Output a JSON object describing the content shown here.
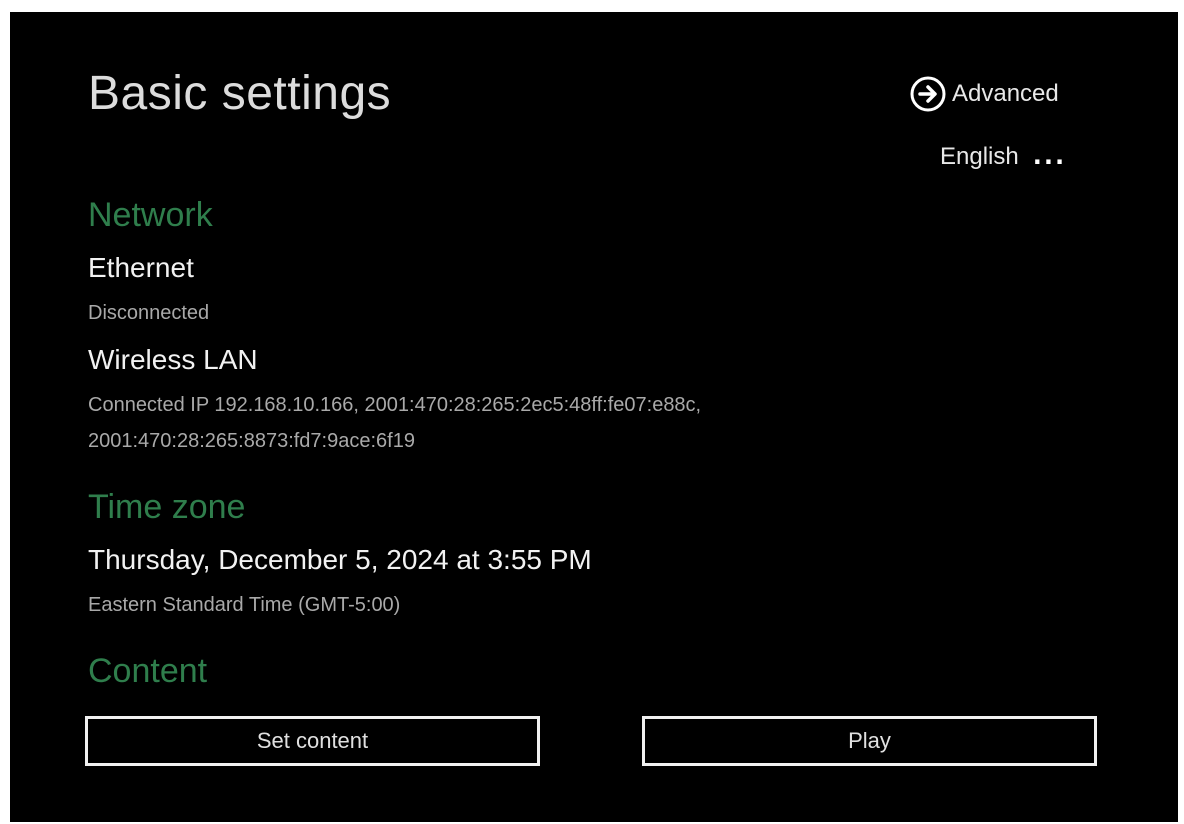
{
  "header": {
    "title": "Basic settings",
    "advanced_label": "Advanced",
    "language_label": "English",
    "more_label": "..."
  },
  "network": {
    "heading": "Network",
    "ethernet": {
      "title": "Ethernet",
      "status": "Disconnected"
    },
    "wireless": {
      "title": "Wireless LAN",
      "status_line1": "Connected IP 192.168.10.166, 2001:470:28:265:2ec5:48ff:fe07:e88c,",
      "status_line2": "2001:470:28:265:8873:fd7:9ace:6f19"
    }
  },
  "time_zone": {
    "heading": "Time zone",
    "datetime": "Thursday, December 5, 2024 at 3:55 PM",
    "zone": "Eastern Standard Time (GMT-5:00)"
  },
  "content": {
    "heading": "Content",
    "set_content_label": "Set content",
    "play_label": "Play"
  },
  "colors": {
    "background": "#000000",
    "section_heading": "#2f7e4c",
    "text": "#f2f2f2",
    "subtext": "#a9a9a9"
  },
  "icons": {
    "advanced": "arrow-circle-right-icon"
  }
}
